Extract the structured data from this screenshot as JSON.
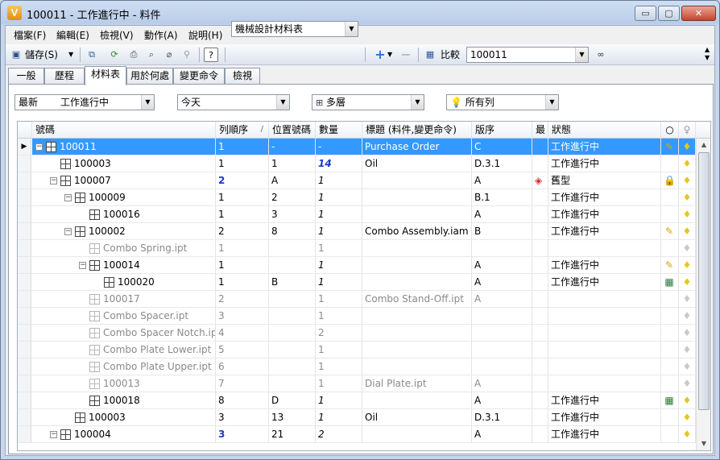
{
  "window": {
    "title": "100011 - 工作進行中 - 料件",
    "app_icon": "V",
    "controls": {
      "minimize": "▭",
      "maximize": "▢",
      "close": "✕"
    }
  },
  "menu": [
    "檔案(F)",
    "編輯(E)",
    "檢視(V)",
    "動作(A)",
    "說明(H)"
  ],
  "toolbar": {
    "save_label": "儲存(S)",
    "bom_view": "機械設計材料表",
    "compare_label": "比較",
    "compare_value": "100011"
  },
  "tabs": [
    "一般",
    "歷程",
    "材料表",
    "用於何處",
    "變更命令",
    "檢視"
  ],
  "active_tab": 2,
  "filters": {
    "revision": "最新",
    "state": "工作進行中",
    "date": "今天",
    "levels": "多層",
    "rows": "所有列"
  },
  "columns": {
    "number": "號碼",
    "row_order": "列順序",
    "sort_mark": "/",
    "position": "位置號碼",
    "qty": "數量",
    "title": "標題 (料件,變更命令)",
    "revision": "版序",
    "latest": "最",
    "status": "狀態"
  },
  "rows": [
    {
      "number": "100011",
      "row": "1",
      "pos": "-",
      "qty": "-",
      "title": "Purchase Order",
      "rev": "C",
      "status": "工作進行中",
      "level": 0,
      "type": "asm",
      "exp": "−",
      "selected": true,
      "icon": "pencil",
      "bulb": true
    },
    {
      "number": "100003",
      "row": "1",
      "pos": "1",
      "qty": "14",
      "title": "Oil",
      "rev": "D.3.1",
      "status": "工作進行中",
      "level": 1,
      "type": "asm",
      "exp": "",
      "qty_style": "bluebold",
      "bulb": true
    },
    {
      "number": "100007",
      "row": "2",
      "pos": "A",
      "qty": "1",
      "title": "",
      "rev": "A",
      "status": "舊型",
      "level": 1,
      "type": "asm",
      "exp": "−",
      "row_style": "bluebold",
      "icon": "lock",
      "obsolete": true,
      "bulb": true
    },
    {
      "number": "100009",
      "row": "1",
      "pos": "2",
      "qty": "1",
      "title": "",
      "rev": "B.1",
      "status": "工作進行中",
      "level": 2,
      "type": "asm",
      "exp": "−",
      "bulb": true
    },
    {
      "number": "100016",
      "row": "1",
      "pos": "3",
      "qty": "1",
      "title": "",
      "rev": "A",
      "status": "工作進行中",
      "level": 3,
      "type": "asm",
      "exp": "",
      "bulb": true
    },
    {
      "number": "100002",
      "row": "2",
      "pos": "8",
      "qty": "1",
      "title": "Combo Assembly.iam",
      "rev": "B",
      "status": "工作進行中",
      "level": 2,
      "type": "asm",
      "exp": "−",
      "icon": "pencil",
      "bulb": true
    },
    {
      "number": "Combo Spring.ipt",
      "row": "1",
      "pos": "",
      "qty": "1",
      "title": "",
      "rev": "",
      "status": "",
      "level": 3,
      "type": "part",
      "exp": "",
      "grey": true,
      "bulb": false
    },
    {
      "number": "100014",
      "row": "1",
      "pos": "",
      "qty": "1",
      "title": "",
      "rev": "A",
      "status": "工作進行中",
      "level": 3,
      "type": "asm",
      "exp": "−",
      "icon": "pencil",
      "bulb": true
    },
    {
      "number": "100020",
      "row": "1",
      "pos": "B",
      "qty": "1",
      "title": "",
      "rev": "A",
      "status": "工作進行中",
      "level": 4,
      "type": "asm",
      "exp": "",
      "icon": "newitem",
      "bulb": true
    },
    {
      "number": "100017",
      "row": "2",
      "pos": "",
      "qty": "1",
      "title": "Combo Stand-Off.ipt",
      "rev": "A",
      "status": "",
      "level": 3,
      "type": "part",
      "exp": "",
      "grey": true,
      "bulb": false
    },
    {
      "number": "Combo Spacer.ipt",
      "row": "3",
      "pos": "",
      "qty": "1",
      "title": "",
      "rev": "",
      "status": "",
      "level": 3,
      "type": "part",
      "exp": "",
      "grey": true,
      "bulb": false
    },
    {
      "number": "Combo Spacer Notch.ipt",
      "row": "4",
      "pos": "",
      "qty": "2",
      "title": "",
      "rev": "",
      "status": "",
      "level": 3,
      "type": "part",
      "exp": "",
      "grey": true,
      "bulb": false
    },
    {
      "number": "Combo Plate Lower.ipt",
      "row": "5",
      "pos": "",
      "qty": "1",
      "title": "",
      "rev": "",
      "status": "",
      "level": 3,
      "type": "part",
      "exp": "",
      "grey": true,
      "bulb": false
    },
    {
      "number": "Combo Plate Upper.ipt",
      "row": "6",
      "pos": "",
      "qty": "1",
      "title": "",
      "rev": "",
      "status": "",
      "level": 3,
      "type": "part",
      "exp": "",
      "grey": true,
      "bulb": false
    },
    {
      "number": "100013",
      "row": "7",
      "pos": "",
      "qty": "1",
      "title": "Dial Plate.ipt",
      "rev": "A",
      "status": "",
      "level": 3,
      "type": "part",
      "exp": "",
      "grey": true,
      "bulb": false
    },
    {
      "number": "100018",
      "row": "8",
      "pos": "D",
      "qty": "1",
      "title": "",
      "rev": "A",
      "status": "工作進行中",
      "level": 3,
      "type": "asm",
      "exp": "",
      "icon": "newitem",
      "bulb": true
    },
    {
      "number": "100003",
      "row": "3",
      "pos": "13",
      "qty": "1",
      "title": "Oil",
      "rev": "D.3.1",
      "status": "工作進行中",
      "level": 2,
      "type": "asm",
      "exp": "",
      "bulb": true
    },
    {
      "number": "100004",
      "row": "3",
      "pos": "21",
      "qty": "2",
      "title": "",
      "rev": "A",
      "status": "工作進行中",
      "level": 1,
      "type": "asm",
      "exp": "−",
      "row_style": "bluebold",
      "bulb": true
    }
  ]
}
